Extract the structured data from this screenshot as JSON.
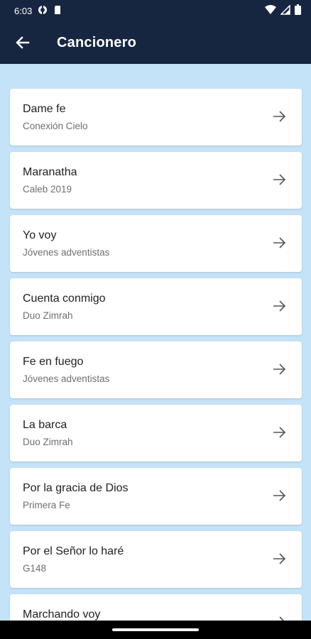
{
  "status_bar": {
    "time": "6:03"
  },
  "app_bar": {
    "title": "Cancionero"
  },
  "songs": [
    {
      "title": "Dame fe",
      "artist": "Conexión Cielo"
    },
    {
      "title": "Maranatha",
      "artist": "Caleb 2019"
    },
    {
      "title": "Yo voy",
      "artist": "Jóvenes adventistas"
    },
    {
      "title": "Cuenta conmigo",
      "artist": "Duo Zimrah"
    },
    {
      "title": "Fe en fuego",
      "artist": "Jóvenes adventistas"
    },
    {
      "title": "La barca",
      "artist": "Duo Zimrah"
    },
    {
      "title": "Por la gracia de Dios",
      "artist": "Primera Fe"
    },
    {
      "title": "Por el Señor lo haré",
      "artist": "G148"
    },
    {
      "title": "Marchando voy",
      "artist": ""
    }
  ],
  "colors": {
    "app_bar": "#172640",
    "background": "#c5e3f8",
    "card": "#ffffff"
  }
}
